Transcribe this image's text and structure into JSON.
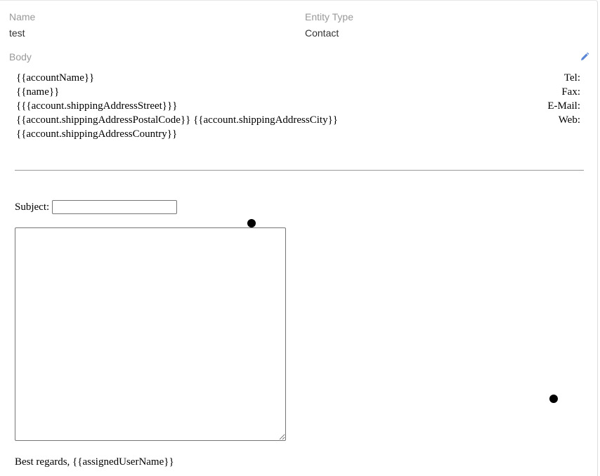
{
  "fields": {
    "name_label": "Name",
    "name_value": "test",
    "entity_label": "Entity Type",
    "entity_value": "Contact",
    "body_label": "Body"
  },
  "body": {
    "address_lines": [
      "{{accountName}}",
      "{{name}}",
      "{{{account.shippingAddressStreet}}}",
      "{{account.shippingAddressPostalCode}} {{account.shippingAddressCity}}",
      "{{account.shippingAddressCountry}}"
    ],
    "contact_lines": [
      "Tel:",
      "Fax:",
      "E-Mail:",
      "Web:"
    ],
    "subject_label": "Subject:",
    "subject_value": "",
    "message_value": "",
    "closing": "Best regards, {{assignedUserName}}"
  },
  "icons": {
    "edit": "pencil-icon"
  },
  "colors": {
    "accent": "#5b86d6",
    "label": "#999999"
  }
}
